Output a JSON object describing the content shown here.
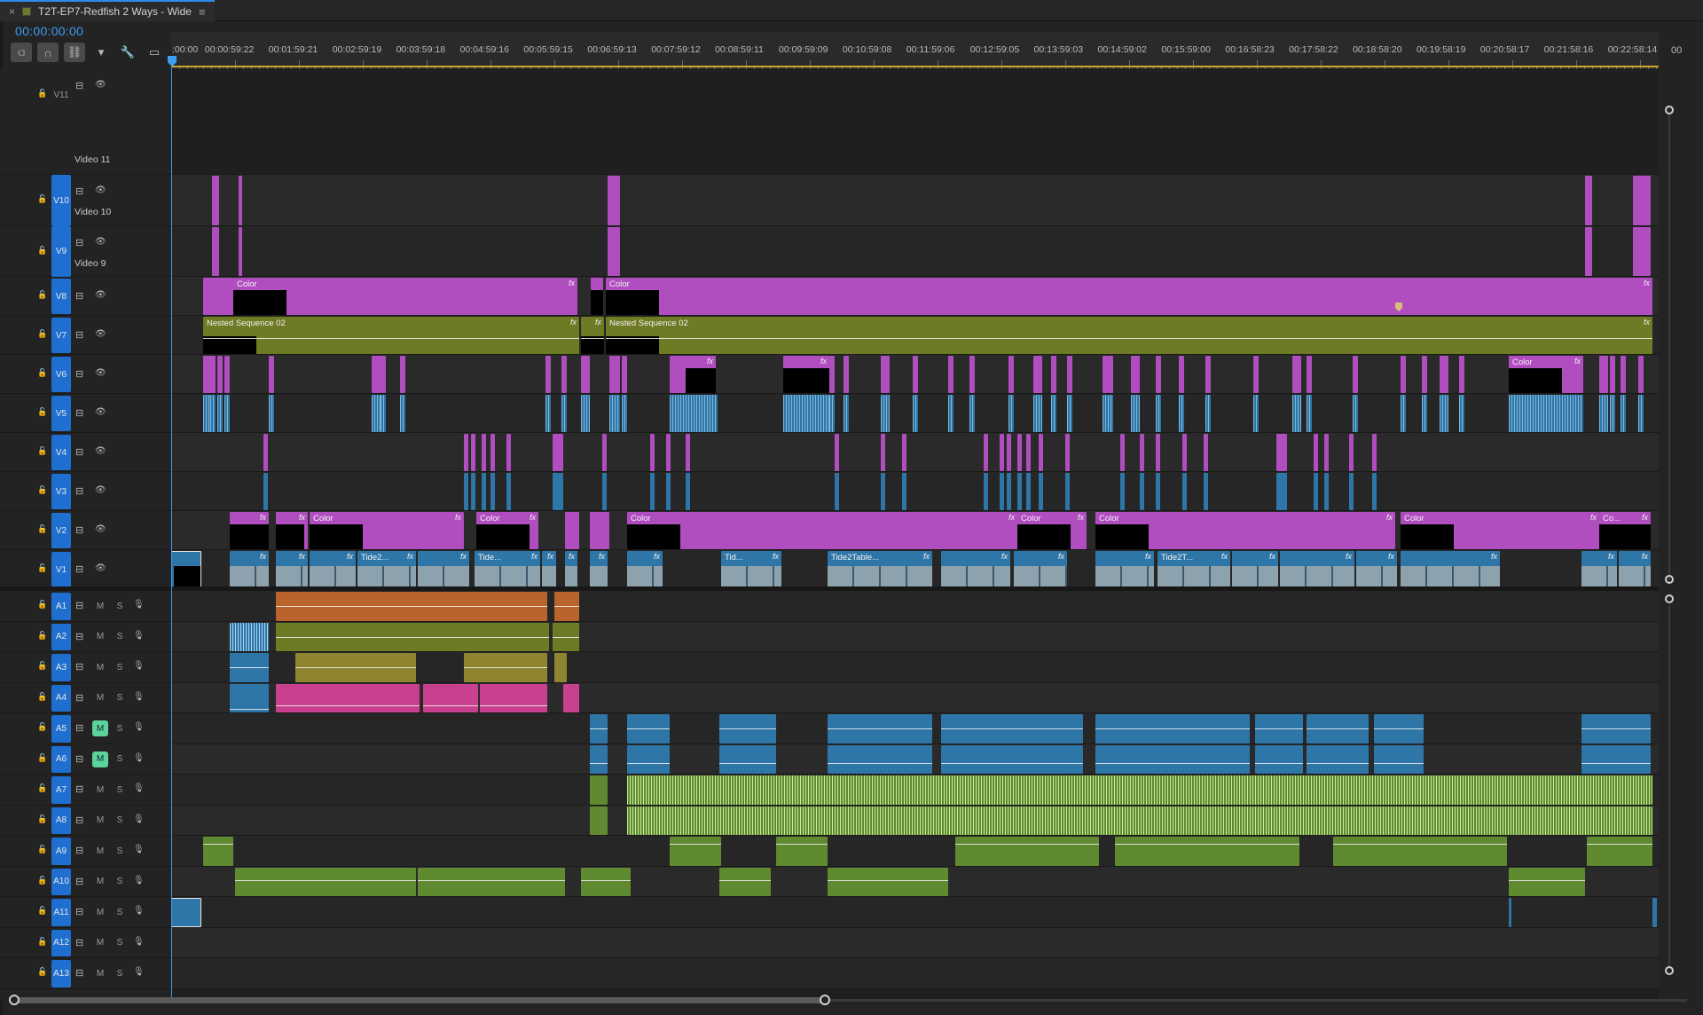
{
  "tab": {
    "title": "T2T-EP7-Redfish 2 Ways - Wide",
    "close": "×",
    "menu": "≡"
  },
  "timecode": "00:00:00:00",
  "tools": [
    {
      "name": "insert-overwrite-icon",
      "glyph": "⫏",
      "active": true
    },
    {
      "name": "snap-magnet-icon",
      "glyph": "∩",
      "active": true
    },
    {
      "name": "linked-selection-icon",
      "glyph": "⛓",
      "active": true
    },
    {
      "name": "add-marker-icon",
      "glyph": "▾",
      "active": false
    },
    {
      "name": "wrench-icon",
      "glyph": "🔧",
      "active": false
    },
    {
      "name": "captions-icon",
      "glyph": "▭",
      "active": false
    }
  ],
  "ruler": {
    "labels": [
      ":00:00",
      "00:00:59:22",
      "00:01:59:21",
      "00:02:59:19",
      "00:03:59:18",
      "00:04:59:16",
      "00:05:59:15",
      "00:06:59:13",
      "00:07:59:12",
      "00:08:59:11",
      "00:09:59:09",
      "00:10:59:08",
      "00:11:59:06",
      "00:12:59:05",
      "00:13:59:03",
      "00:14:59:02",
      "00:15:59:00",
      "00:16:58:23",
      "00:17:58:22",
      "00:18:58:20",
      "00:19:58:19",
      "00:20:58:17",
      "00:21:58:16",
      "00:22:58:14"
    ],
    "end_label": "00"
  },
  "colors": {
    "magenta": "#b04dbf",
    "olive": "#6f7a24",
    "blue": "#2f76a8",
    "orange": "#b9632d",
    "pink": "#c8408e",
    "mustard": "#8f8530",
    "green_audio": "#5f8a30",
    "light_green": "#c7ec9a",
    "target_blue": "#1f6fd1"
  },
  "tracks": {
    "video": [
      {
        "id": "V11",
        "label": "Video 11",
        "targeted": false
      },
      {
        "id": "V10",
        "label": "Video 10",
        "targeted": true
      },
      {
        "id": "V9",
        "label": "Video 9",
        "targeted": true
      },
      {
        "id": "V8",
        "label": "",
        "targeted": true
      },
      {
        "id": "V7",
        "label": "",
        "targeted": true
      },
      {
        "id": "V6",
        "label": "",
        "targeted": true
      },
      {
        "id": "V5",
        "label": "",
        "targeted": true
      },
      {
        "id": "V4",
        "label": "",
        "targeted": true
      },
      {
        "id": "V3",
        "label": "",
        "targeted": true
      },
      {
        "id": "V2",
        "label": "",
        "targeted": true
      },
      {
        "id": "V1",
        "label": "",
        "targeted": true
      }
    ],
    "audio": [
      {
        "id": "A1",
        "muted": false
      },
      {
        "id": "A2",
        "muted": false
      },
      {
        "id": "A3",
        "muted": false
      },
      {
        "id": "A4",
        "muted": false
      },
      {
        "id": "A5",
        "muted": true
      },
      {
        "id": "A6",
        "muted": true
      },
      {
        "id": "A7",
        "muted": false
      },
      {
        "id": "A8",
        "muted": false
      },
      {
        "id": "A9",
        "muted": false
      },
      {
        "id": "A10",
        "muted": false
      },
      {
        "id": "A11",
        "muted": false
      },
      {
        "id": "A12",
        "muted": false
      },
      {
        "id": "A13",
        "muted": false
      }
    ],
    "audio_buttons": {
      "mute": "M",
      "solo": "S"
    }
  },
  "clip_labels": {
    "color": "Color",
    "nested": "Nested Sequence 02",
    "fx": "fx",
    "tide2": "Tide2...",
    "tide": "Tide...",
    "tid": "Tid...",
    "tide2table": "Tide2Table...",
    "tide2t": "Tide2T...",
    "co": "Co..."
  }
}
